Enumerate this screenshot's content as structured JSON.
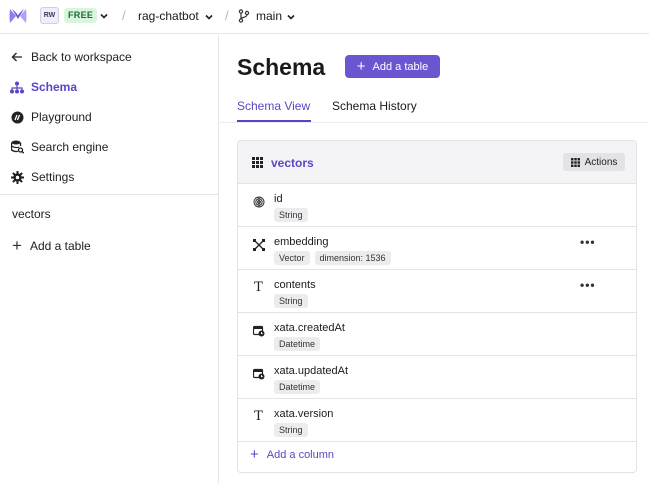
{
  "topbar": {
    "workspace_initials": "RW",
    "plan": "FREE",
    "database": "rag-chatbot",
    "branch": "main",
    "separator": "/"
  },
  "sidebar": {
    "back_label": "Back to workspace",
    "items": [
      {
        "label": "Schema",
        "icon": "schema-tree-icon",
        "active": true
      },
      {
        "label": "Playground",
        "icon": "playground-icon",
        "active": false
      },
      {
        "label": "Search engine",
        "icon": "search-engine-icon",
        "active": false
      },
      {
        "label": "Settings",
        "icon": "gear-icon",
        "active": false
      }
    ],
    "tables": [
      "vectors"
    ],
    "add_table_label": "Add a table"
  },
  "main": {
    "title": "Schema",
    "add_table_button": "Add a table",
    "tabs": [
      {
        "label": "Schema View",
        "active": true
      },
      {
        "label": "Schema History",
        "active": false
      }
    ]
  },
  "table_card": {
    "name": "vectors",
    "actions_label": "Actions",
    "columns": [
      {
        "name": "id",
        "types": [
          "String"
        ],
        "icon": "id-fingerprint-icon",
        "has_menu": false
      },
      {
        "name": "embedding",
        "types": [
          "Vector",
          "dimension: 1536"
        ],
        "icon": "vector-icon",
        "has_menu": true
      },
      {
        "name": "contents",
        "types": [
          "String"
        ],
        "icon": "text-type-icon",
        "has_menu": true
      },
      {
        "name": "xata.createdAt",
        "types": [
          "Datetime"
        ],
        "icon": "calendar-clock-icon",
        "has_menu": false
      },
      {
        "name": "xata.updatedAt",
        "types": [
          "Datetime"
        ],
        "icon": "calendar-clock-icon",
        "has_menu": false
      },
      {
        "name": "xata.version",
        "types": [
          "String"
        ],
        "icon": "text-type-icon",
        "has_menu": false
      }
    ],
    "more_label": "•••",
    "add_column_label": "Add a column"
  },
  "colors": {
    "accent": "#5b45c7",
    "button": "#6b55d1",
    "free_badge_bg": "#d9f5dd",
    "free_badge_fg": "#1d6b34"
  }
}
